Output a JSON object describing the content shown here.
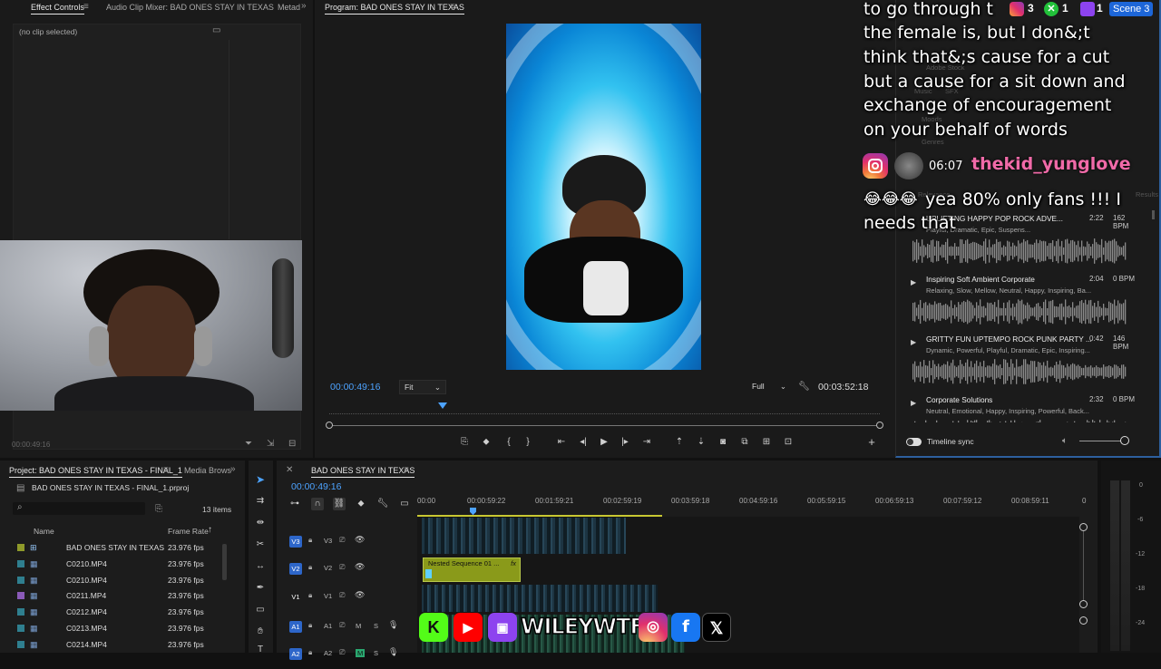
{
  "effect_panel": {
    "tabs": [
      "Effect Controls",
      "Audio Clip Mixer: BAD ONES STAY IN TEXAS",
      "Metad"
    ],
    "no_clip": "(no clip selected)",
    "timecode": "00:00:49:16"
  },
  "program": {
    "title": "Program: BAD ONES STAY IN TEXAS",
    "current_tc": "00:00:49:16",
    "zoom": "Fit",
    "quality": "Full",
    "duration_tc": "00:03:52:18",
    "playhead_fraction": 0.206
  },
  "project": {
    "tabs": [
      "Project: BAD ONES STAY IN TEXAS - FINAL_1",
      "Media Brows"
    ],
    "file": "BAD ONES STAY IN TEXAS - FINAL_1.prproj",
    "item_count": "13 items",
    "col_name": "Name",
    "col_fps": "Frame Rate",
    "rows": [
      {
        "name": "BAD ONES STAY IN TEXAS",
        "fps": "23.976 fps",
        "color": "#8f9a2a",
        "icon": "sequence-icon"
      },
      {
        "name": "C0210.MP4",
        "fps": "23.976 fps",
        "color": "#2f7f8f",
        "icon": "clip-icon"
      },
      {
        "name": "C0210.MP4",
        "fps": "23.976 fps",
        "color": "#2f7f8f",
        "icon": "clip-icon"
      },
      {
        "name": "C0211.MP4",
        "fps": "23.976 fps",
        "color": "#8a5ab8",
        "icon": "clip-icon"
      },
      {
        "name": "C0212.MP4",
        "fps": "23.976 fps",
        "color": "#2f7f8f",
        "icon": "clip-icon"
      },
      {
        "name": "C0213.MP4",
        "fps": "23.976 fps",
        "color": "#2f7f8f",
        "icon": "clip-icon"
      },
      {
        "name": "C0214.MP4",
        "fps": "23.976 fps",
        "color": "#2f7f8f",
        "icon": "clip-icon"
      }
    ]
  },
  "timeline": {
    "title": "BAD ONES STAY IN TEXAS",
    "current_tc": "00:00:49:16",
    "ruler": [
      "00:00",
      "00:00:59:22",
      "00:01:59:21",
      "00:02:59:19",
      "00:03:59:18",
      "00:04:59:16",
      "00:05:59:15",
      "00:06:59:13",
      "00:07:59:12",
      "00:08:59:11",
      "0"
    ],
    "tracks": [
      {
        "id": "V3",
        "label": "V3"
      },
      {
        "id": "V2",
        "label": "V2"
      },
      {
        "id": "V1",
        "label": "V1"
      },
      {
        "id": "A1",
        "label": "A1"
      },
      {
        "id": "A2",
        "label": "A2"
      }
    ],
    "nested_clip": "Nested Sequence 01 ...",
    "nested_fx": "fx",
    "meter_scale": [
      "0",
      "-6",
      "-12",
      "-18",
      "-24"
    ],
    "mute_label": "M",
    "solo_label": "S"
  },
  "overlay": {
    "chat_lines": [
      "to go through t",
      "the female is, but I don&;t",
      "think that&;s cause for a cut",
      "but a cause for a sit down and",
      "exchange of encouragement",
      "on your behalf of words"
    ],
    "chat_time": "06:07",
    "chat_user": "thekid_yunglove",
    "chat_msg_emoji": "😂😂😂",
    "chat_msg_line1": "yea 80% only fans !!! I",
    "chat_msg_line2": "needs that",
    "viewer_badges": [
      "3",
      "1",
      "1"
    ],
    "scene": "Scene 3",
    "social_handle": "WILEYWTF"
  },
  "essential_sound": {
    "faint": [
      "Adobe Stock",
      "Music",
      "SFX",
      "Moods",
      "Genres",
      "Relevance",
      "Results"
    ],
    "items": [
      {
        "title": "UPLIFTING HAPPY POP ROCK ADVE...",
        "dur": "2:22",
        "bpm": "162 BPM",
        "tags": "Playful, Dramatic, Epic, Suspens..."
      },
      {
        "title": "Inspiring Soft Ambient Corporate",
        "dur": "2:04",
        "bpm": "0 BPM",
        "tags": "Relaxing, Slow, Mellow, Neutral, Happy, Inspiring, Ba..."
      },
      {
        "title": "GRITTY FUN UPTEMPO ROCK PUNK PARTY ...",
        "dur": "0:42",
        "bpm": "146 BPM",
        "tags": "Dynamic, Powerful, Playful, Dramatic, Epic, Inspiring..."
      },
      {
        "title": "Corporate Solutions",
        "dur": "2:32",
        "bpm": "0 BPM",
        "tags": "Neutral, Emotional, Happy, Inspiring, Powerful, Back..."
      }
    ],
    "timeline_sync": "Timeline sync"
  },
  "colors": {
    "accent_blue": "#5aa0ff",
    "timecode_blue": "#4da3ff",
    "username_pink": "#f06aa8",
    "nested_clip": "#8a9a1a"
  }
}
